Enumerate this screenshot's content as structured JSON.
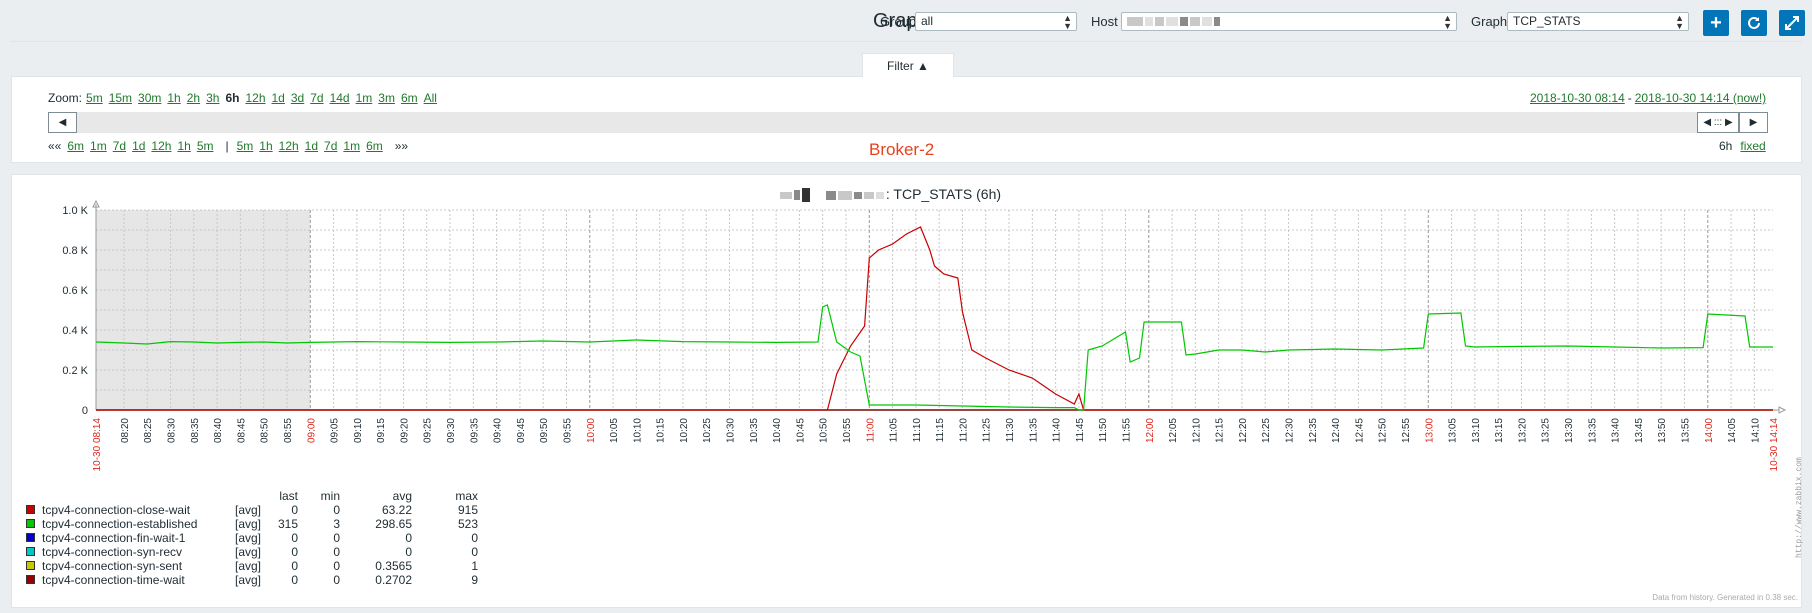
{
  "header": {
    "title": "Grap",
    "group_label": "Group",
    "group_value": "all",
    "host_label": "Host",
    "graph_label": "Graph",
    "graph_value": "TCP_STATS"
  },
  "filter": {
    "tab_label": "Filter ▲",
    "zoom_label": "Zoom:",
    "zoom_options": [
      "5m",
      "15m",
      "30m",
      "1h",
      "2h",
      "3h",
      "6h",
      "12h",
      "1d",
      "3d",
      "7d",
      "14d",
      "1m",
      "3m",
      "6m",
      "All"
    ],
    "zoom_selected": "6h",
    "range_start": "2018-10-30 08:14",
    "range_sep": "-",
    "range_end": "2018-10-30 14:14 (now!)",
    "back_first": "««",
    "back_options": [
      "6m",
      "1m",
      "7d",
      "1d",
      "12h",
      "1h",
      "5m"
    ],
    "sep": "|",
    "fwd_options": [
      "5m",
      "1h",
      "12h",
      "1d",
      "7d",
      "1m",
      "6m"
    ],
    "fwd_last": "»»",
    "period": "6h",
    "fixed": "fixed",
    "broker_label": "Broker-2"
  },
  "graph": {
    "title_suffix": ": TCP_STATS (6h)",
    "footer": "Data from history. Generated in 0.38 sec.",
    "watermark": "http://www.zabbix.com",
    "colors": {
      "close_wait": "#c80000",
      "established": "#00c800",
      "fin_wait_1": "#0000c8",
      "syn_recv": "#00c8c8",
      "syn_sent": "#c8c800",
      "time_wait": "#960000"
    }
  },
  "chart_data": {
    "type": "line",
    "title": ": TCP_STATS (6h)",
    "x_unit": "time (2018-10-30)",
    "y_ticks": [
      "0",
      "0.2 K",
      "0.4 K",
      "0.6 K",
      "0.8 K",
      "1.0 K"
    ],
    "ylim": [
      0,
      1000
    ],
    "x_start_label": "10-30 08:14",
    "x_end_label": "10-30 14:14",
    "x_ticks": [
      "08:20",
      "08:25",
      "08:30",
      "08:35",
      "08:40",
      "08:45",
      "08:50",
      "08:55",
      "09:00",
      "09:05",
      "09:10",
      "09:15",
      "09:20",
      "09:25",
      "09:30",
      "09:35",
      "09:40",
      "09:45",
      "09:50",
      "09:55",
      "10:00",
      "10:05",
      "10:10",
      "10:15",
      "10:20",
      "10:25",
      "10:30",
      "10:35",
      "10:40",
      "10:45",
      "10:50",
      "10:55",
      "11:00",
      "11:05",
      "11:10",
      "11:15",
      "11:20",
      "11:25",
      "11:30",
      "11:35",
      "11:40",
      "11:45",
      "11:50",
      "11:55",
      "12:00",
      "12:05",
      "12:10",
      "12:15",
      "12:20",
      "12:25",
      "12:30",
      "12:35",
      "12:40",
      "12:45",
      "12:50",
      "12:55",
      "13:00",
      "13:05",
      "13:10",
      "13:15",
      "13:20",
      "13:25",
      "13:30",
      "13:35",
      "13:40",
      "13:45",
      "13:50",
      "13:55",
      "14:00",
      "14:05",
      "14:10"
    ],
    "grid": true,
    "no_data_until": "09:00",
    "series": [
      {
        "name": "tcpv4-connection-established",
        "points": [
          [
            "08:14",
            340
          ],
          [
            "08:20",
            335
          ],
          [
            "08:25",
            330
          ],
          [
            "08:30",
            342
          ],
          [
            "08:35",
            340
          ],
          [
            "08:40",
            335
          ],
          [
            "08:45",
            338
          ],
          [
            "08:50",
            340
          ],
          [
            "08:55",
            335
          ],
          [
            "09:00",
            338
          ],
          [
            "09:10",
            342
          ],
          [
            "09:20",
            340
          ],
          [
            "09:30",
            338
          ],
          [
            "09:40",
            340
          ],
          [
            "09:50",
            345
          ],
          [
            "10:00",
            340
          ],
          [
            "10:10",
            350
          ],
          [
            "10:20",
            342
          ],
          [
            "10:30",
            340
          ],
          [
            "10:40",
            338
          ],
          [
            "10:49",
            340
          ],
          [
            "10:50",
            515
          ],
          [
            "10:51",
            525
          ],
          [
            "10:53",
            340
          ],
          [
            "10:56",
            290
          ],
          [
            "10:58",
            270
          ],
          [
            "11:00",
            25
          ],
          [
            "11:10",
            25
          ],
          [
            "11:20",
            20
          ],
          [
            "11:30",
            15
          ],
          [
            "11:40",
            12
          ],
          [
            "11:44",
            12
          ],
          [
            "11:45",
            0
          ],
          [
            "11:46",
            0
          ],
          [
            "11:47",
            300
          ],
          [
            "11:50",
            320
          ],
          [
            "11:55",
            390
          ],
          [
            "11:56",
            240
          ],
          [
            "11:58",
            260
          ],
          [
            "11:59",
            440
          ],
          [
            "12:05",
            440
          ],
          [
            "12:07",
            440
          ],
          [
            "12:08",
            275
          ],
          [
            "12:10",
            280
          ],
          [
            "12:15",
            300
          ],
          [
            "12:20",
            300
          ],
          [
            "12:25",
            290
          ],
          [
            "12:30",
            300
          ],
          [
            "12:40",
            305
          ],
          [
            "12:50",
            300
          ],
          [
            "12:59",
            310
          ],
          [
            "13:00",
            480
          ],
          [
            "13:07",
            485
          ],
          [
            "13:08",
            320
          ],
          [
            "13:10",
            315
          ],
          [
            "13:20",
            318
          ],
          [
            "13:30",
            320
          ],
          [
            "13:40",
            315
          ],
          [
            "13:50",
            310
          ],
          [
            "13:59",
            312
          ],
          [
            "14:00",
            480
          ],
          [
            "14:08",
            470
          ],
          [
            "14:09",
            315
          ],
          [
            "14:14",
            315
          ]
        ]
      },
      {
        "name": "tcpv4-connection-close-wait",
        "points": [
          [
            "08:14",
            0
          ],
          [
            "10:49",
            0
          ],
          [
            "10:51",
            0
          ],
          [
            "10:53",
            180
          ],
          [
            "10:56",
            320
          ],
          [
            "10:59",
            420
          ],
          [
            "11:00",
            760
          ],
          [
            "11:02",
            800
          ],
          [
            "11:05",
            830
          ],
          [
            "11:08",
            880
          ],
          [
            "11:11",
            915
          ],
          [
            "11:13",
            800
          ],
          [
            "11:14",
            720
          ],
          [
            "11:16",
            680
          ],
          [
            "11:19",
            660
          ],
          [
            "11:20",
            490
          ],
          [
            "11:22",
            300
          ],
          [
            "11:25",
            260
          ],
          [
            "11:30",
            200
          ],
          [
            "11:35",
            160
          ],
          [
            "11:40",
            80
          ],
          [
            "11:44",
            30
          ],
          [
            "11:45",
            80
          ],
          [
            "11:46",
            0
          ],
          [
            "14:14",
            0
          ]
        ]
      },
      {
        "name": "tcpv4-connection-fin-wait-1",
        "points": [
          [
            "08:14",
            0
          ],
          [
            "14:14",
            0
          ]
        ]
      },
      {
        "name": "tcpv4-connection-syn-recv",
        "points": [
          [
            "08:14",
            0
          ],
          [
            "14:14",
            0
          ]
        ]
      },
      {
        "name": "tcpv4-connection-syn-sent",
        "points": [
          [
            "08:14",
            0
          ],
          [
            "14:14",
            0
          ]
        ]
      },
      {
        "name": "tcpv4-connection-time-wait",
        "points": [
          [
            "08:14",
            0
          ],
          [
            "14:14",
            0
          ]
        ]
      }
    ]
  },
  "legend": {
    "headers": {
      "last": "last",
      "min": "min",
      "avg": "avg",
      "max": "max"
    },
    "rows": [
      {
        "name": "tcpv4-connection-close-wait",
        "func": "[avg]",
        "last": "0",
        "min": "0",
        "avg": "63.22",
        "max": "915",
        "color": "#c80000"
      },
      {
        "name": "tcpv4-connection-established",
        "func": "[avg]",
        "last": "315",
        "min": "3",
        "avg": "298.65",
        "max": "523",
        "color": "#00c800"
      },
      {
        "name": "tcpv4-connection-fin-wait-1",
        "func": "[avg]",
        "last": "0",
        "min": "0",
        "avg": "0",
        "max": "0",
        "color": "#0000c8"
      },
      {
        "name": "tcpv4-connection-syn-recv",
        "func": "[avg]",
        "last": "0",
        "min": "0",
        "avg": "0",
        "max": "0",
        "color": "#00c8c8"
      },
      {
        "name": "tcpv4-connection-syn-sent",
        "func": "[avg]",
        "last": "0",
        "min": "0",
        "avg": "0.3565",
        "max": "1",
        "color": "#c8c800"
      },
      {
        "name": "tcpv4-connection-time-wait",
        "func": "[avg]",
        "last": "0",
        "min": "0",
        "avg": "0.2702",
        "max": "9",
        "color": "#960000"
      }
    ]
  }
}
